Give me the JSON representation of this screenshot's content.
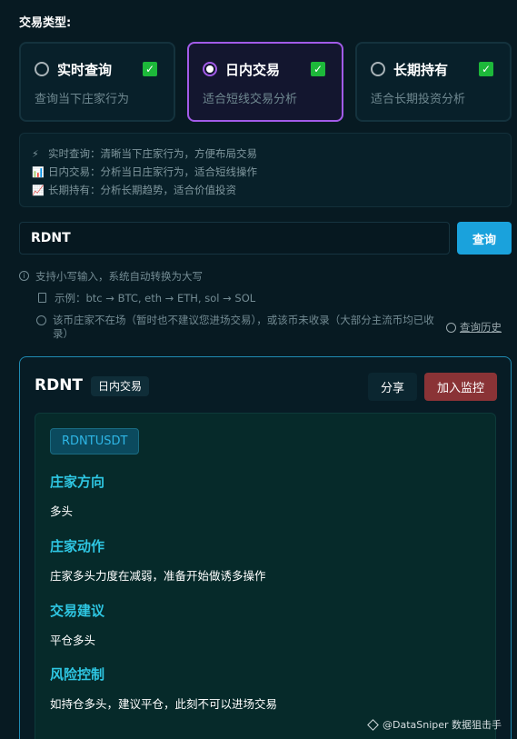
{
  "section_label": "交易类型:",
  "trade_types": [
    {
      "title": "实时查询",
      "desc": "查询当下庄家行为",
      "selected": false
    },
    {
      "title": "日内交易",
      "desc": "适合短线交易分析",
      "selected": true
    },
    {
      "title": "长期持有",
      "desc": "适合长期投资分析",
      "selected": false
    }
  ],
  "info": [
    {
      "icon": "⚡",
      "text": "实时查询：清晰当下庄家行为，方便布局交易"
    },
    {
      "icon": "📊",
      "text": "日内交易：分析当日庄家行为，适合短线操作"
    },
    {
      "icon": "📈",
      "text": "长期持有：分析长期趋势，适合价值投资"
    }
  ],
  "search": {
    "value": "RDNT",
    "button": "查询"
  },
  "hints": {
    "lowercase": "支持小写输入，系统自动转换为大写",
    "example": "示例：btc → BTC, eth → ETH, sol → SOL",
    "notice": "该币庄家不在场（暂时也不建议您进场交易），或该币未收录（大部分主流币均已收录）",
    "history": "查询历史"
  },
  "result": {
    "symbol": "RDNT",
    "badge": "日内交易",
    "share": "分享",
    "monitor": "加入监控",
    "pair": "RDNTUSDT",
    "sections": [
      {
        "title": "庄家方向",
        "value": "多头"
      },
      {
        "title": "庄家动作",
        "value": "庄家多头力度在减弱，准备开始做诱多操作"
      },
      {
        "title": "交易建议",
        "value": "平仓多头"
      },
      {
        "title": "风险控制",
        "value": "如持仓多头，建议平仓，此刻不可以进场交易"
      }
    ]
  },
  "watermark": "@DataSniper 数据狙击手",
  "colors": {
    "accent": "#1aa2dc",
    "selected": "#a25be8",
    "danger": "#8a3336",
    "heading": "#2ec6e2"
  }
}
